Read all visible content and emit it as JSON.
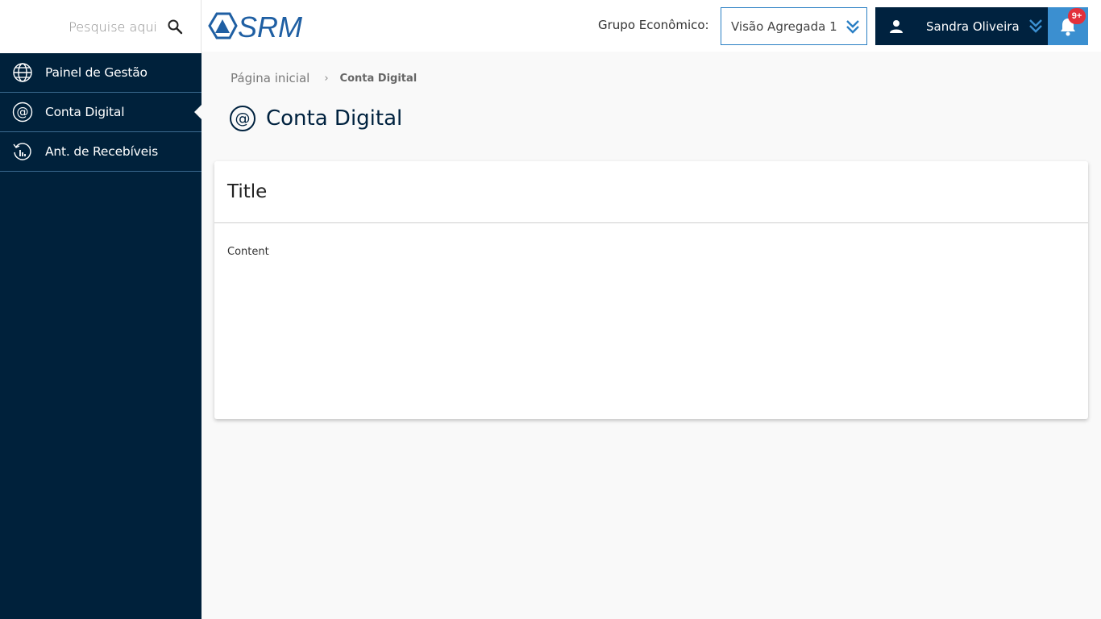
{
  "search": {
    "placeholder": "Pesquise aqui",
    "icon": "search-icon"
  },
  "header": {
    "brand": "SRM",
    "group_label": "Grupo Econômico:",
    "group_value": "Visão Agregada 1",
    "user_name": "Sandra Oliveira",
    "notifications_badge": "9+"
  },
  "sidebar": {
    "items": [
      {
        "label": "Painel de Gestão",
        "icon": "globe-icon"
      },
      {
        "label": "Conta Digital",
        "icon": "at-sign-icon",
        "active": true
      },
      {
        "label": "Ant. de Recebíveis",
        "icon": "history-chart-icon"
      }
    ]
  },
  "breadcrumb": {
    "home": "Página inicial",
    "separator": "›",
    "current": "Conta Digital"
  },
  "page": {
    "title": "Conta Digital"
  },
  "card": {
    "title": "Title",
    "content": "Content"
  },
  "colors": {
    "navy": "#00223f",
    "accent": "#3b8fd0",
    "badge": "#e3303b",
    "select_border": "#2a7fc4"
  }
}
